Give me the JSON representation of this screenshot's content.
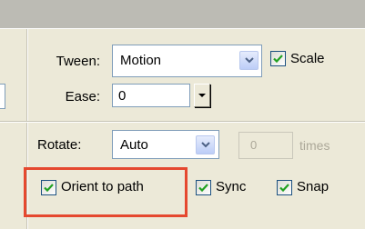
{
  "tween": {
    "label": "Tween:",
    "value": "Motion",
    "scale_label": "Scale",
    "scale_checked": true
  },
  "ease": {
    "label": "Ease:",
    "value": "0"
  },
  "rotate": {
    "label": "Rotate:",
    "value": "Auto",
    "count_value": "0",
    "times_label": "times"
  },
  "options": {
    "orient_label": "Orient to path",
    "orient_checked": true,
    "sync_label": "Sync",
    "sync_checked": true,
    "snap_label": "Snap",
    "snap_checked": true
  },
  "colors": {
    "highlight": "#e5482f",
    "check": "#21a121",
    "panel": "#ece9d8"
  },
  "icons": [
    "chevron-down-icon",
    "dropdown-arrow-icon",
    "checkmark-icon"
  ]
}
